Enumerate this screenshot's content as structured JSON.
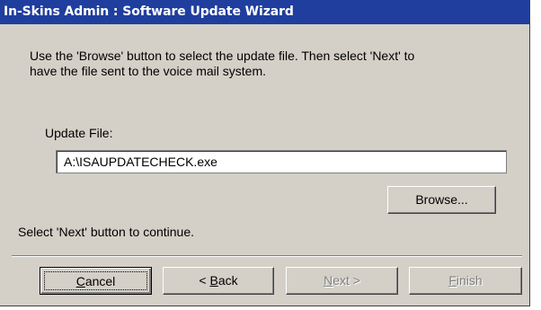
{
  "window": {
    "title": "In-Skins Admin : Software Update Wizard"
  },
  "instructions": {
    "line1": "Use the 'Browse' button to select the update file. Then select 'Next' to",
    "line2": "have the file sent to the voice mail system."
  },
  "update_file": {
    "label": "Update File:",
    "value": "A:\\ISAUPDATECHECK.exe"
  },
  "browse_label": "Browse...",
  "status_text": "Select 'Next' button to continue.",
  "buttons": {
    "cancel": {
      "mnemonic": "C",
      "rest": "ancel"
    },
    "back": {
      "prefix": "< ",
      "mnemonic": "B",
      "rest": "ack"
    },
    "next": {
      "mnemonic": "N",
      "rest": "ext >"
    },
    "finish": {
      "mnemonic": "F",
      "rest": "inish"
    }
  },
  "colors": {
    "titlebar": "#1f3e9d",
    "face": "#d4d0c8",
    "disabled_text": "#808080"
  }
}
